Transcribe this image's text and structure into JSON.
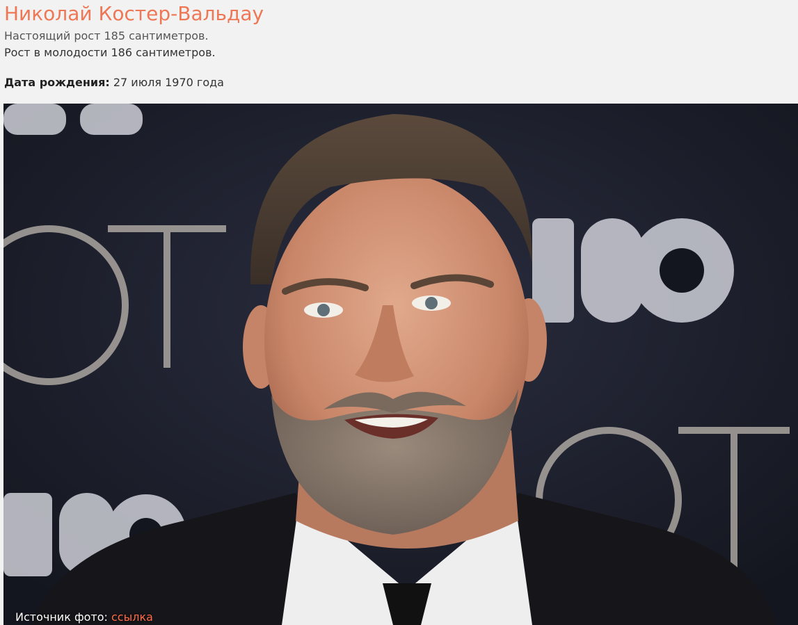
{
  "header": {
    "title": "Николай Костер-Вальдау",
    "height_real": "Настоящий рост 185 сантиметров.",
    "height_young": "Рост в молодости 186 сантиметров.",
    "birth_label": "Дата рождения:",
    "birth_value": "27 июля 1970 года"
  },
  "photo": {
    "backdrop_text": [
      "HBO",
      "GOT"
    ],
    "caption_label": "Источник фото:",
    "caption_link": "ссылка"
  },
  "colors": {
    "title": "#ee7755",
    "link": "#ff6a45",
    "backdrop": "#1b1d2c"
  }
}
